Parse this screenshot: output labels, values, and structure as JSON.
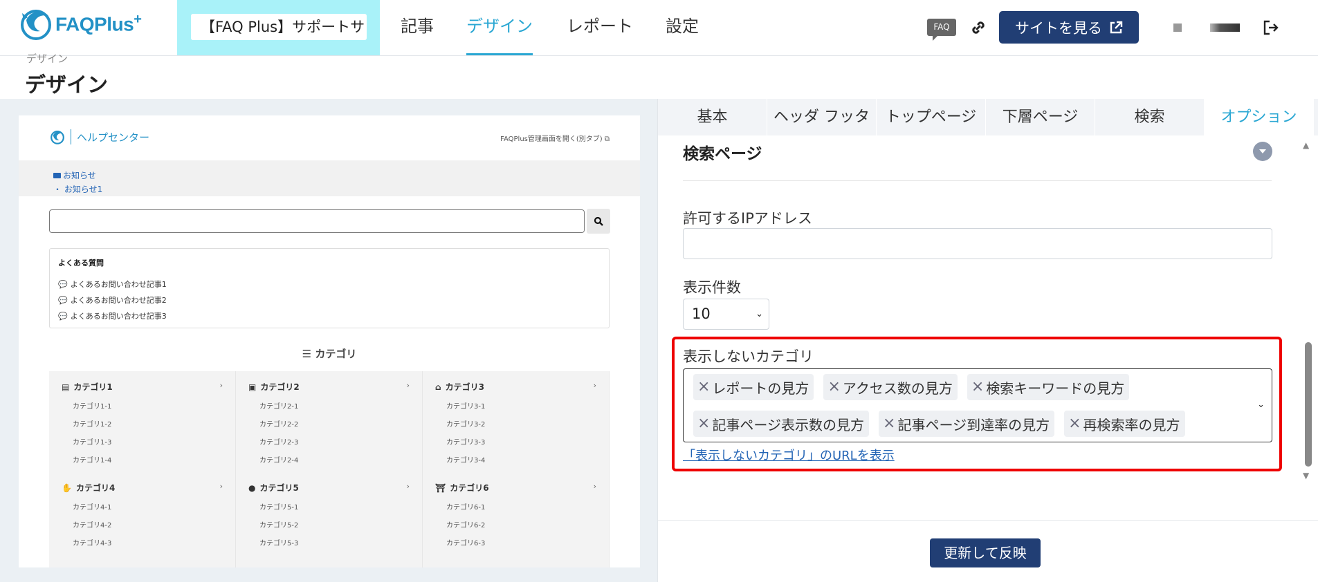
{
  "header": {
    "logo_text": "FAQPlus",
    "logo_sup": "+",
    "site_select": "【FAQ Plus】サポートサ",
    "nav": [
      "記事",
      "デザイン",
      "レポート",
      "設定"
    ],
    "faq_badge": "FAQ",
    "view_site": "サイトを見る"
  },
  "page": {
    "breadcrumb": "デザイン",
    "title": "デザイン"
  },
  "preview": {
    "brand": "ヘルプセンター",
    "admin_link": "FAQPlus管理画面を開く(別タブ)",
    "news_label": "お知らせ",
    "news_item": "・ お知らせ1",
    "faq_heading": "よくある質問",
    "faq_items": [
      "よくあるお問い合わせ記事1",
      "よくあるお問い合わせ記事2",
      "よくあるお問い合わせ記事3"
    ],
    "category_heading": "カテゴリ",
    "categories": [
      {
        "name": "カテゴリ1",
        "icon": "newspaper-icon",
        "subs": [
          "カテゴリ1-1",
          "カテゴリ1-2",
          "カテゴリ1-3",
          "カテゴリ1-4"
        ]
      },
      {
        "name": "カテゴリ2",
        "icon": "square-icon",
        "subs": [
          "カテゴリ2-1",
          "カテゴリ2-2",
          "カテゴリ2-3",
          "カテゴリ2-4"
        ]
      },
      {
        "name": "カテゴリ3",
        "icon": "building-icon",
        "subs": [
          "カテゴリ3-1",
          "カテゴリ3-2",
          "カテゴリ3-3",
          "カテゴリ3-4"
        ]
      },
      {
        "name": "カテゴリ4",
        "icon": "hand-icon",
        "subs": [
          "カテゴリ4-1",
          "カテゴリ4-2",
          "カテゴリ4-3"
        ]
      },
      {
        "name": "カテゴリ5",
        "icon": "apple-icon",
        "subs": [
          "カテゴリ5-1",
          "カテゴリ5-2",
          "カテゴリ5-3"
        ]
      },
      {
        "name": "カテゴリ6",
        "icon": "gate-icon",
        "subs": [
          "カテゴリ6-1",
          "カテゴリ6-2",
          "カテゴリ6-3"
        ]
      }
    ]
  },
  "settings": {
    "tabs": [
      "基本",
      "ヘッダ フッタ",
      "トップページ",
      "下層ページ",
      "検索",
      "オプション"
    ],
    "active_tab": "オプション",
    "section_title": "検索ページ",
    "ip_label": "許可するIPアドレス",
    "ip_value": "",
    "count_label": "表示件数",
    "count_value": "10",
    "hidden_label": "表示しないカテゴリ",
    "hidden_tags": [
      "レポートの見方",
      "アクセス数の見方",
      "検索キーワードの見方",
      "記事ページ表示数の見方",
      "記事ページ到達率の見方",
      "再検索率の見方"
    ],
    "url_link": "「表示しないカテゴリ」のURLを表示",
    "update_button": "更新して反映"
  },
  "colors": {
    "accent": "#2aa7d3",
    "primary_button": "#213e74",
    "highlight_box": "#ee0000",
    "site_block": "#a9f2f9"
  }
}
